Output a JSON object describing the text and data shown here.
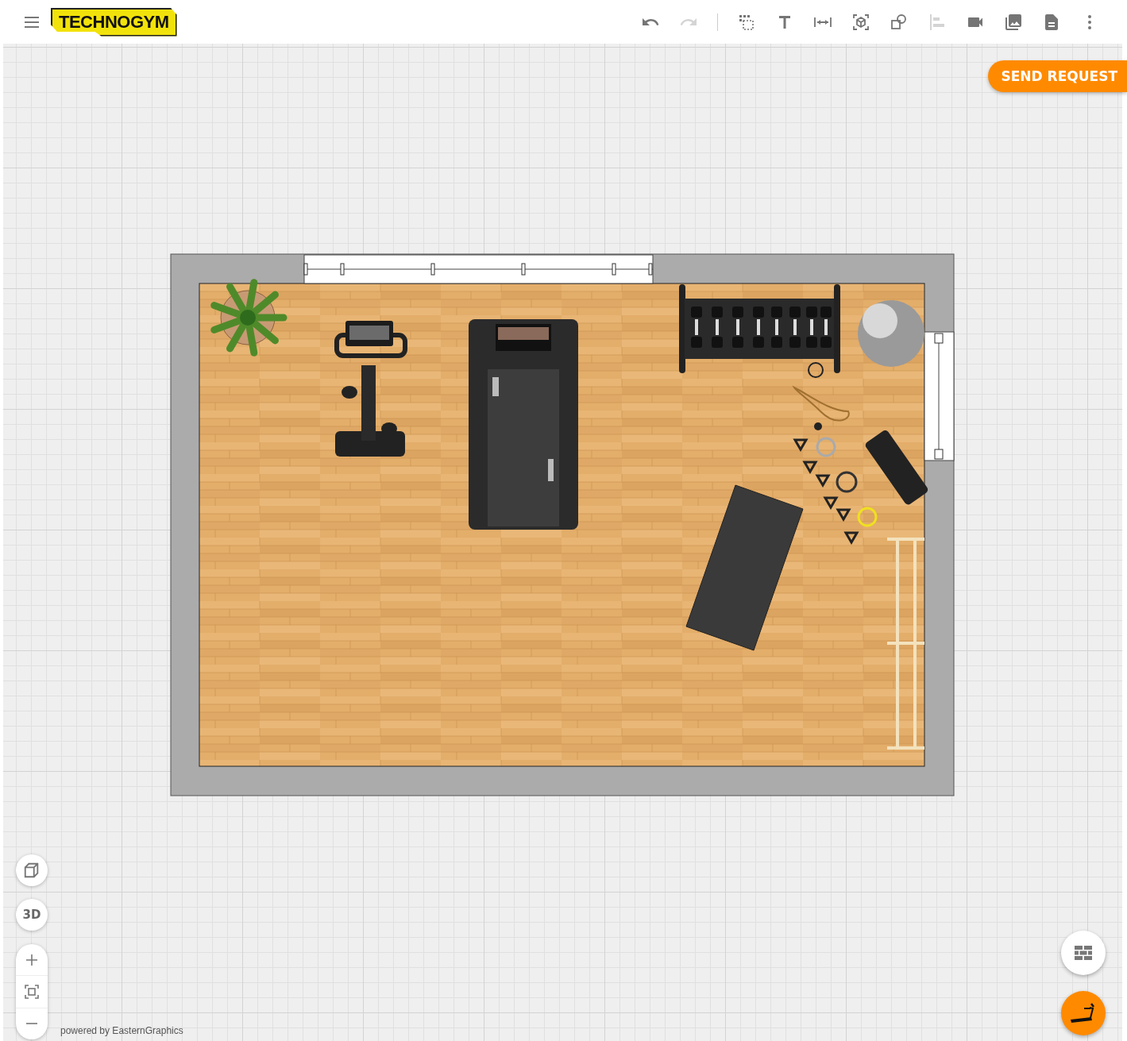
{
  "header": {
    "logo_text": "TECHNOGYM",
    "tools": [
      {
        "kind": "undo",
        "disabled": false
      },
      {
        "kind": "redo",
        "disabled": true
      },
      {
        "kind": "divider"
      },
      {
        "kind": "select",
        "disabled": false
      },
      {
        "kind": "text",
        "disabled": false
      },
      {
        "kind": "measure",
        "disabled": false
      },
      {
        "kind": "object",
        "disabled": false
      },
      {
        "kind": "shapes",
        "disabled": false
      },
      {
        "kind": "align",
        "disabled": true
      },
      {
        "kind": "camera",
        "disabled": false
      },
      {
        "kind": "image",
        "disabled": false
      },
      {
        "kind": "document",
        "disabled": false
      },
      {
        "kind": "more",
        "disabled": false
      }
    ]
  },
  "send_request": "SEND REQUEST",
  "view_controls": {
    "mode_label": "3D"
  },
  "footer": "powered by EasternGraphics"
}
